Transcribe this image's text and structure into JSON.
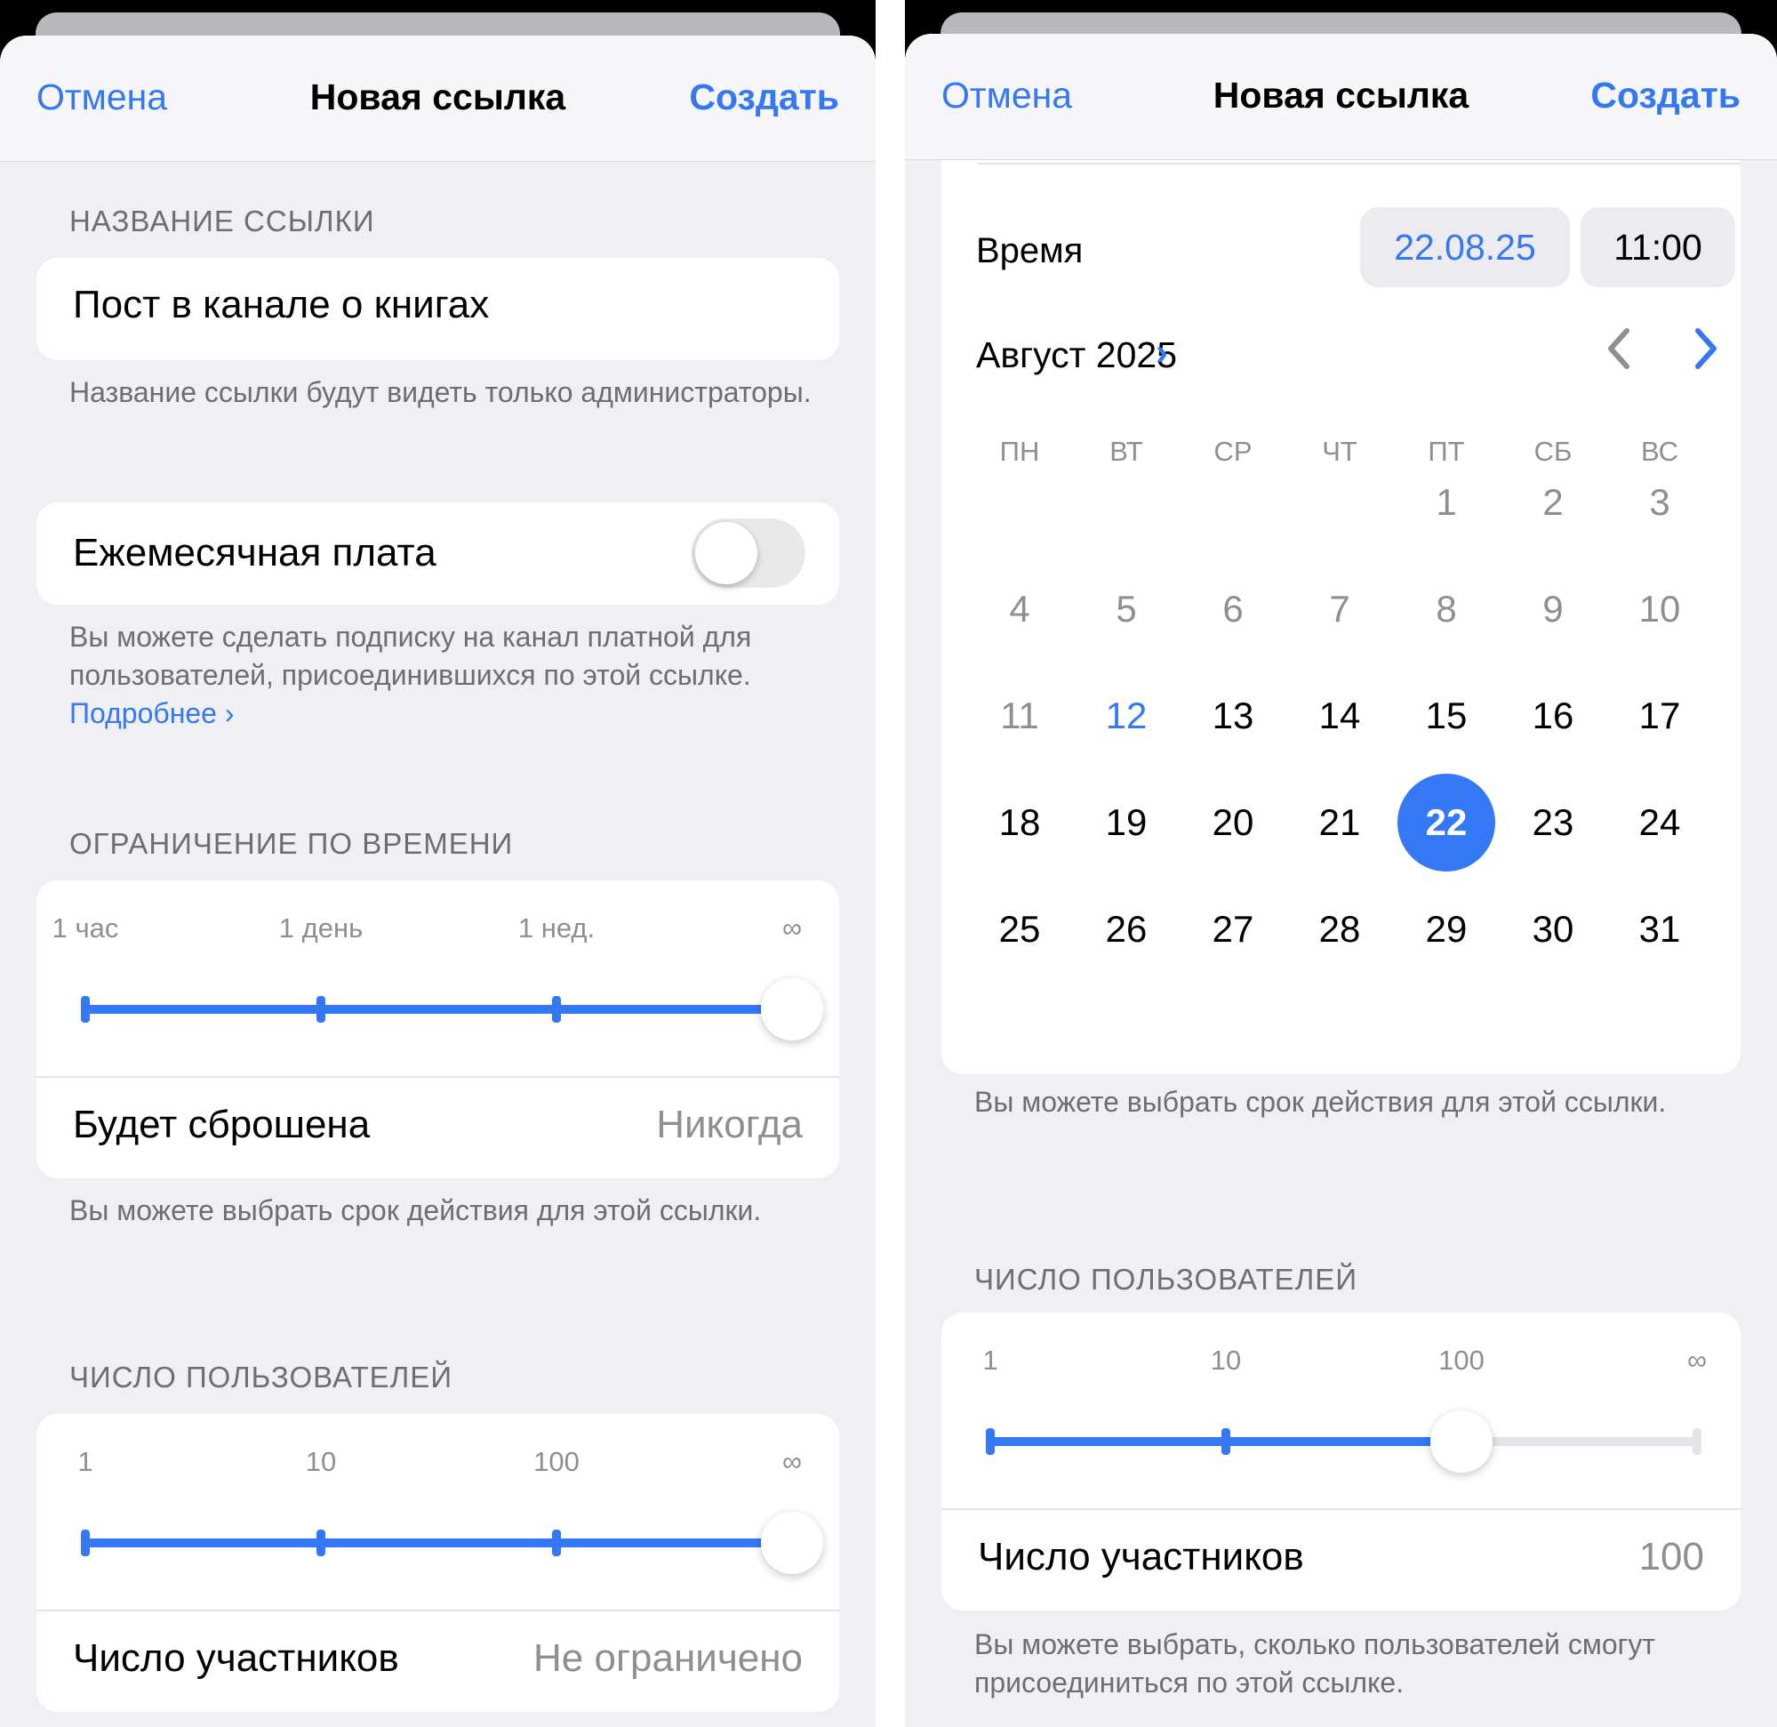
{
  "colors": {
    "accent": "#3478f6",
    "secondary_text": "#6d6d72",
    "background": "#efeff4"
  },
  "left": {
    "nav": {
      "cancel": "Отмена",
      "title": "Новая ссылка",
      "create": "Создать"
    },
    "link_name": {
      "header": "НАЗВАНИЕ ССЫЛКИ",
      "value": "Пост в канале о книгах",
      "footnote": "Название ссылки будут видеть только администраторы."
    },
    "monthly_fee": {
      "label": "Ежемесячная плата",
      "enabled": false,
      "footnote": "Вы можете сделать подписку на канал платной для пользователей, присоединившихся по этой ссылке.",
      "more_link": "Подробнее ›"
    },
    "time_limit": {
      "header": "ОГРАНИЧЕНИЕ ПО ВРЕМЕНИ",
      "ticks": [
        "1 час",
        "1 день",
        "1 нед.",
        "∞"
      ],
      "selected_index": 3,
      "row_label": "Будет сброшена",
      "row_value": "Никогда",
      "footnote": "Вы можете выбрать срок действия для этой ссылки."
    },
    "user_limit": {
      "header": "ЧИСЛО ПОЛЬЗОВАТЕЛЕЙ",
      "ticks": [
        "1",
        "10",
        "100",
        "∞"
      ],
      "selected_index": 3,
      "row_label": "Число участников",
      "row_value": "Не ограничено"
    }
  },
  "right": {
    "nav": {
      "cancel": "Отмена",
      "title": "Новая ссылка",
      "create": "Создать"
    },
    "time": {
      "label": "Время",
      "date": "22.08.25",
      "clock": "11:00"
    },
    "calendar": {
      "month_label": "Август 2025",
      "month_chevron": "›",
      "prev_icon": "chevron-left",
      "next_icon": "chevron-right",
      "weekdays": [
        "ПН",
        "ВТ",
        "СР",
        "ЧТ",
        "ПТ",
        "СБ",
        "ВС"
      ],
      "first_weekday_index": 4,
      "days_in_month": 31,
      "today": 12,
      "selected": 22
    },
    "time_footnote": "Вы можете выбрать срок действия для этой ссылки.",
    "user_limit": {
      "header": "ЧИСЛО ПОЛЬЗОВАТЕЛЕЙ",
      "ticks": [
        "1",
        "10",
        "100",
        "∞"
      ],
      "selected_index": 2,
      "row_label": "Число участников",
      "row_value": "100",
      "footnote": "Вы можете выбрать, сколько пользователей смогут присоединиться по этой ссылке."
    }
  }
}
